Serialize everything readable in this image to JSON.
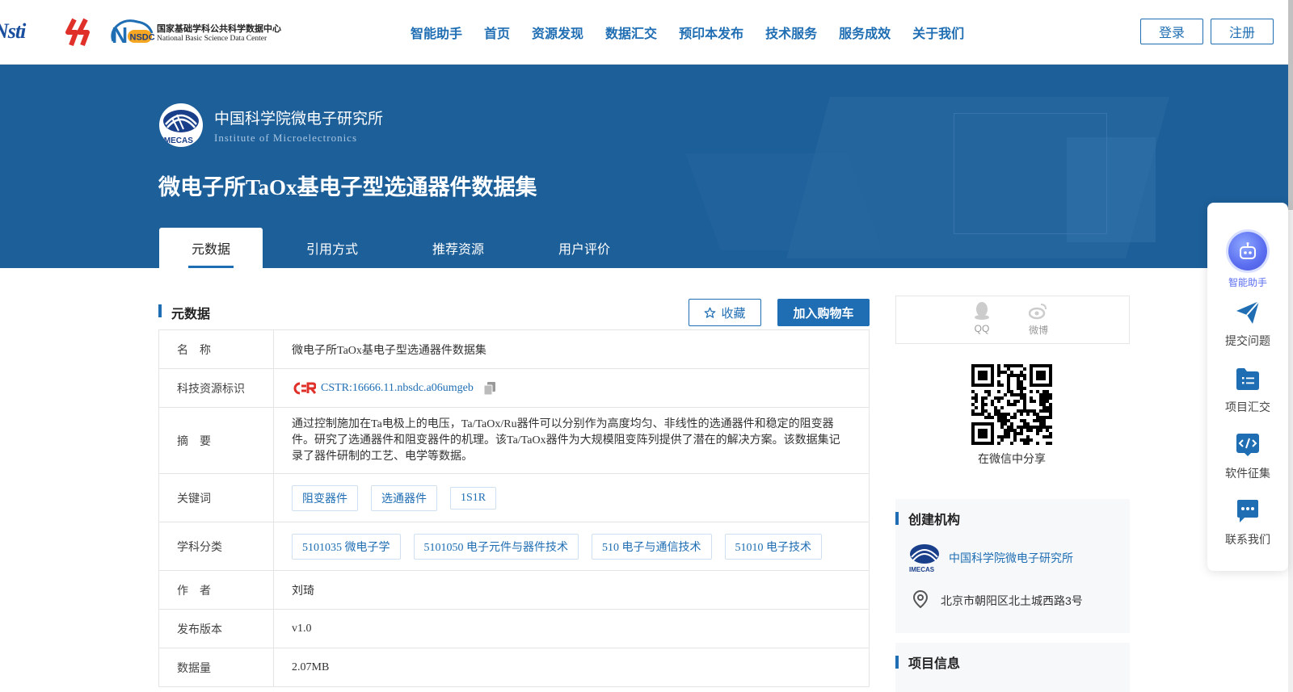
{
  "header": {
    "logos": {
      "nsti": "Nsti",
      "nsdc_badge": "NSDC",
      "nsdc_cn": "国家基础学科公共科学数据中心",
      "nsdc_en": "National Basic Science Data Center"
    },
    "nav": [
      "智能助手",
      "首页",
      "资源发现",
      "数据汇交",
      "预印本发布",
      "技术服务",
      "服务成效",
      "关于我们"
    ],
    "login": "登录",
    "register": "注册"
  },
  "banner": {
    "institution_cn": "中国科学院微电子研究所",
    "institution_en": "Institute of Microelectronics",
    "logo_text": "IMECAS",
    "dataset_title": "微电子所TaOx基电子型选通器件数据集",
    "tabs": [
      "元数据",
      "引用方式",
      "推荐资源",
      "用户评价"
    ]
  },
  "section": {
    "title": "元数据",
    "favorite": "收藏",
    "add_to_cart": "加入购物车"
  },
  "metadata": {
    "name_label": "名　称",
    "name_value": "微电子所TaOx基电子型选通器件数据集",
    "id_label": "科技资源标识",
    "id_value": "CSTR:16666.11.nbsdc.a06umgeb",
    "abstract_label": "摘　要",
    "abstract_value": "通过控制施加在Ta电极上的电压，Ta/TaOx/Ru器件可以分别作为高度均匀、非线性的选通器件和稳定的阻变器件。研究了选通器件和阻变器件的机理。该Ta/TaOx器件为大规模阻变阵列提供了潜在的解决方案。该数据集记录了器件研制的工艺、电学等数据。",
    "keywords_label": "关键词",
    "keywords": [
      "阻变器件",
      "选通器件",
      "1S1R"
    ],
    "subject_label": "学科分类",
    "subjects": [
      "5101035 微电子学",
      "5101050 电子元件与器件技术",
      "510 电子与通信技术",
      "51010 电子技术"
    ],
    "author_label": "作　者",
    "author_value": "刘琦",
    "version_label": "发布版本",
    "version_value": "v1.0",
    "size_label": "数据量",
    "size_value": "2.07MB"
  },
  "sidebar_right": {
    "share_qq": "QQ",
    "share_weibo": "微博",
    "qr_caption": "在微信中分享",
    "org_title": "创建机构",
    "org_name": "中国科学院微电子研究所",
    "org_logo_text": "IMECAS",
    "org_address": "北京市朝阳区北土城西路3号",
    "project_title": "项目信息"
  },
  "float_toolbar": {
    "assistant": "智能助手",
    "submit": "提交问题",
    "projects": "项目汇交",
    "software": "软件征集",
    "contact": "联系我们"
  },
  "colors": {
    "primary": "#1f6eb3",
    "banner": "#1d5f99",
    "ai_accent": "#5a6df0"
  }
}
